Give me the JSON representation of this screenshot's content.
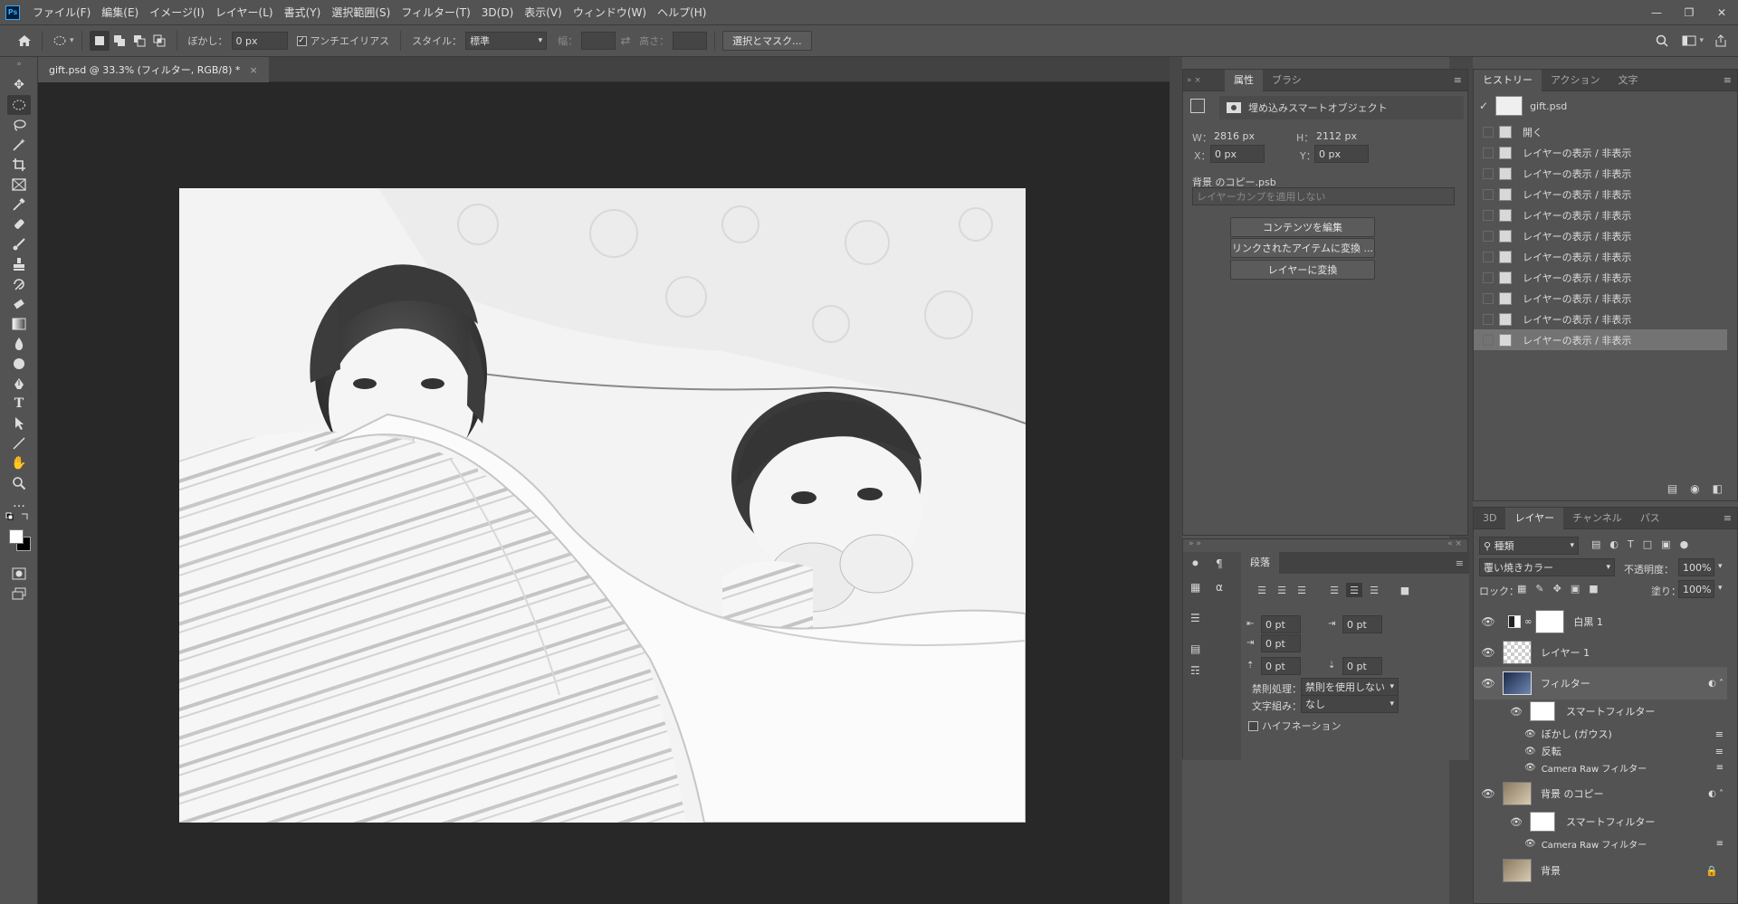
{
  "menubar": {
    "logo": "Ps",
    "items": [
      "ファイル(F)",
      "編集(E)",
      "イメージ(I)",
      "レイヤー(L)",
      "書式(Y)",
      "選択範囲(S)",
      "フィルター(T)",
      "3D(D)",
      "表示(V)",
      "ウィンドウ(W)",
      "ヘルプ(H)"
    ]
  },
  "options": {
    "feather_label": "ぼかし：",
    "feather_value": "0 px",
    "antialias_label": "アンチエイリアス",
    "style_label": "スタイル：",
    "style_value": "標準",
    "width_label": "幅：",
    "height_label": "高さ：",
    "select_mask_button": "選択とマスク..."
  },
  "document": {
    "tab_title": "gift.psd @ 33.3% (フィルター, RGB/8) *"
  },
  "properties": {
    "tabs": [
      "属性",
      "ブラシ"
    ],
    "type_label": "埋め込みスマートオブジェクト",
    "w_label": "W：",
    "w_value": "2816 px",
    "h_label": "H：",
    "h_value": "2112 px",
    "x_label": "X：",
    "x_value": "0 px",
    "y_label": "Y：",
    "y_value": "0 px",
    "source_file": "背景 のコピー.psb",
    "layer_comp": "レイヤーカンプを適用しない",
    "buttons": [
      "コンテンツを編集",
      "リンクされたアイテムに変換 ...",
      "レイヤーに変換"
    ]
  },
  "paragraph": {
    "tab": "段落",
    "indent_left": "0 pt",
    "indent_right": "0 pt",
    "first_line": "0 pt",
    "space_before": "0 pt",
    "space_after": "0 pt",
    "kinsoku_label": "禁則処理：",
    "kinsoku_value": "禁則を使用しない",
    "mojikumi_label": "文字組み：",
    "mojikumi_value": "なし",
    "hyphenation": "ハイフネーション"
  },
  "history": {
    "tabs": [
      "ヒストリー",
      "アクション",
      "文字"
    ],
    "snapshot": "gift.psd",
    "items": [
      "開く",
      "レイヤーの表示 / 非表示",
      "レイヤーの表示 / 非表示",
      "レイヤーの表示 / 非表示",
      "レイヤーの表示 / 非表示",
      "レイヤーの表示 / 非表示",
      "レイヤーの表示 / 非表示",
      "レイヤーの表示 / 非表示",
      "レイヤーの表示 / 非表示",
      "レイヤーの表示 / 非表示",
      "レイヤーの表示 / 非表示"
    ]
  },
  "layers": {
    "tabs": [
      "3D",
      "レイヤー",
      "チャンネル",
      "パス"
    ],
    "filter_kind": "種類",
    "blend_mode": "覆い焼きカラー",
    "opacity_label": "不透明度：",
    "opacity_value": "100%",
    "lock_label": "ロック：",
    "fill_label": "塗り：",
    "fill_value": "100%",
    "rows": [
      {
        "name": "白黒 1"
      },
      {
        "name": "レイヤー 1"
      },
      {
        "name": "フィルター"
      },
      {
        "name": "背景 のコピー"
      },
      {
        "name": "背景"
      }
    ],
    "filter_smart": "スマートフィルター",
    "filter_effects": [
      "ぼかし (ガウス)",
      "反転",
      "Camera Raw フィルター"
    ],
    "copy_smart": "スマートフィルター",
    "copy_effects": [
      "Camera Raw フィルター"
    ]
  }
}
